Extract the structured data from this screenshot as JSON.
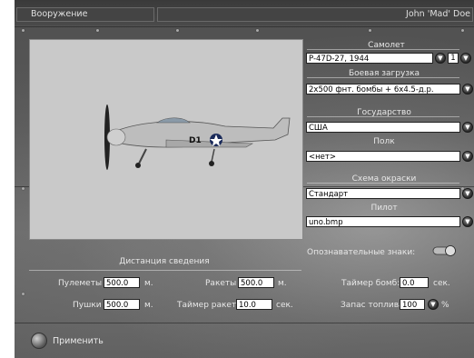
{
  "window": {
    "title": "Вооружение",
    "user": "John 'Mad' Doe"
  },
  "aircraft": {
    "label": "Самолет",
    "value": "P-47D-27, 1944",
    "count": "1"
  },
  "loadout": {
    "label": "Боевая загрузка",
    "value": "2x500 фнт. бомбы + 6x4.5-д.р."
  },
  "country": {
    "label": "Государство",
    "value": "США"
  },
  "regiment": {
    "label": "Полк",
    "value": "<нет>"
  },
  "skin": {
    "label": "Схема окраски",
    "value": "Стандарт"
  },
  "pilot": {
    "label": "Пилот",
    "value": "uno.bmp"
  },
  "markings": {
    "label": "Опознавательные знаки:"
  },
  "convergence": {
    "label": "Дистанция сведения",
    "mg_label": "Пулеметы",
    "mg_value": "500.0",
    "cannon_label": "Пушки",
    "cannon_value": "500.0",
    "rockets_label": "Ракеты",
    "rockets_value": "500.0",
    "unit_m": "м."
  },
  "timers": {
    "rocket_timer_label": "Таймер ракет:",
    "rocket_timer_value": "10.0",
    "bomb_timer_label": "Таймер бомб:",
    "bomb_timer_value": "0.0",
    "unit_sec": "сек."
  },
  "fuel": {
    "label": "Запас топлива",
    "value": "100",
    "unit": "%"
  },
  "apply": {
    "label": "Применить"
  },
  "icons": {
    "dropdown": "chevron-down-icon",
    "apply": "apply-globe-icon",
    "toggle": "toggle-switch-icon"
  }
}
